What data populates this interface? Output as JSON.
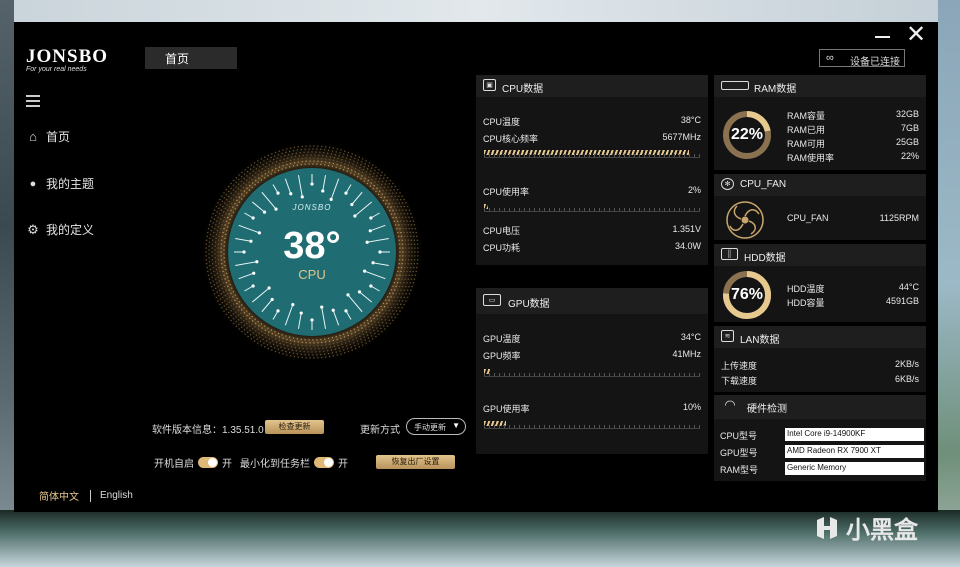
{
  "app": {
    "logo": "JONSBO",
    "tagline": "For your real needs",
    "breadcrumb": "首页",
    "connect_label": "设备已连接",
    "close_glyph": "✕"
  },
  "sidebar": {
    "items": [
      {
        "label": "首页",
        "icon": "home-icon",
        "glyph": "⌂"
      },
      {
        "label": "我的主题",
        "icon": "user-icon",
        "glyph": "👤"
      },
      {
        "label": "我的定义",
        "icon": "gear-icon",
        "glyph": "⚙"
      }
    ],
    "lang_zh": "简体中文",
    "lang_en": "English"
  },
  "gauge": {
    "brand": "JONSBO",
    "value": "38°",
    "label": "CPU",
    "accent": "#1f6d73"
  },
  "settings": {
    "version_label": "软件版本信息：1.35.51.0",
    "check_update": "检查更新",
    "update_mode_label": "更新方式",
    "update_mode_value": "手动更新",
    "autostart_label": "开机自启",
    "autostart_state": "开",
    "minimize_label": "最小化到任务栏",
    "minimize_state": "开",
    "restore_label": "恢复出厂设置"
  },
  "cpu": {
    "title": "CPU数据",
    "temp_label": "CPU温度",
    "temp_value": "38°C",
    "freq_label": "CPU核心频率",
    "freq_value": "5677MHz",
    "freq_fill": 0.95,
    "usage_label": "CPU使用率",
    "usage_value": "2%",
    "usage_fill": 0.02,
    "volt_label": "CPU电压",
    "volt_value": "1.351V",
    "power_label": "CPU功耗",
    "power_value": "34.0W"
  },
  "gpu": {
    "title": "GPU数据",
    "temp_label": "GPU温度",
    "temp_value": "34°C",
    "freq_label": "GPU频率",
    "freq_value": "41MHz",
    "freq_fill": 0.03,
    "usage_label": "GPU使用率",
    "usage_value": "10%",
    "usage_fill": 0.1
  },
  "ram": {
    "title": "RAM数据",
    "percent": "22%",
    "fill": 0.22,
    "rows": [
      {
        "label": "RAM容量",
        "value": "32GB"
      },
      {
        "label": "RAM已用",
        "value": "7GB"
      },
      {
        "label": "RAM可用",
        "value": "25GB"
      },
      {
        "label": "RAM使用率",
        "value": "22%"
      }
    ]
  },
  "fan": {
    "title": "CPU_FAN",
    "label": "CPU_FAN",
    "value": "1125RPM"
  },
  "hdd": {
    "title": "HDD数据",
    "percent": "76%",
    "fill": 0.76,
    "rows": [
      {
        "label": "HDD温度",
        "value": "44°C"
      },
      {
        "label": "HDD容量",
        "value": "4591GB"
      }
    ]
  },
  "lan": {
    "title": "LAN数据",
    "up_label": "上传速度",
    "up_value": "2KB/s",
    "down_label": "下载速度",
    "down_value": "6KB/s"
  },
  "hw": {
    "title": "硬件检测",
    "cpu_label": "CPU型号",
    "cpu_value": "Intel Core i9-14900KF",
    "gpu_label": "GPU型号",
    "gpu_value": "AMD Radeon RX 7900 XT",
    "ram_label": "RAM型号",
    "ram_value": "Generic Memory"
  },
  "watermark": "小黑盒",
  "colors": {
    "gold": "#e0c48e",
    "teal": "#1f6d73",
    "panel": "#141414"
  }
}
